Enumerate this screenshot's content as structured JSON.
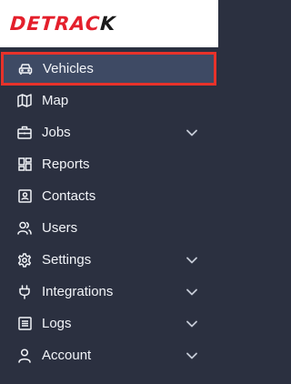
{
  "brand": {
    "part1": "DETRAC",
    "part2": "K"
  },
  "nav": {
    "items": [
      {
        "label": "Vehicles",
        "icon": "car-icon",
        "active": true,
        "expandable": false
      },
      {
        "label": "Map",
        "icon": "map-icon",
        "active": false,
        "expandable": false
      },
      {
        "label": "Jobs",
        "icon": "briefcase-icon",
        "active": false,
        "expandable": true
      },
      {
        "label": "Reports",
        "icon": "dashboard-icon",
        "active": false,
        "expandable": false
      },
      {
        "label": "Contacts",
        "icon": "contact-card-icon",
        "active": false,
        "expandable": false
      },
      {
        "label": "Users",
        "icon": "users-icon",
        "active": false,
        "expandable": false
      },
      {
        "label": "Settings",
        "icon": "gear-icon",
        "active": false,
        "expandable": true
      },
      {
        "label": "Integrations",
        "icon": "plug-icon",
        "active": false,
        "expandable": true
      },
      {
        "label": "Logs",
        "icon": "log-list-icon",
        "active": false,
        "expandable": true
      },
      {
        "label": "Account",
        "icon": "user-icon",
        "active": false,
        "expandable": true
      }
    ]
  },
  "colors": {
    "sidebar_bg": "#2b3040",
    "active_bg": "#3e4a64",
    "active_border": "#e8322a",
    "brand_red": "#e4202c"
  }
}
